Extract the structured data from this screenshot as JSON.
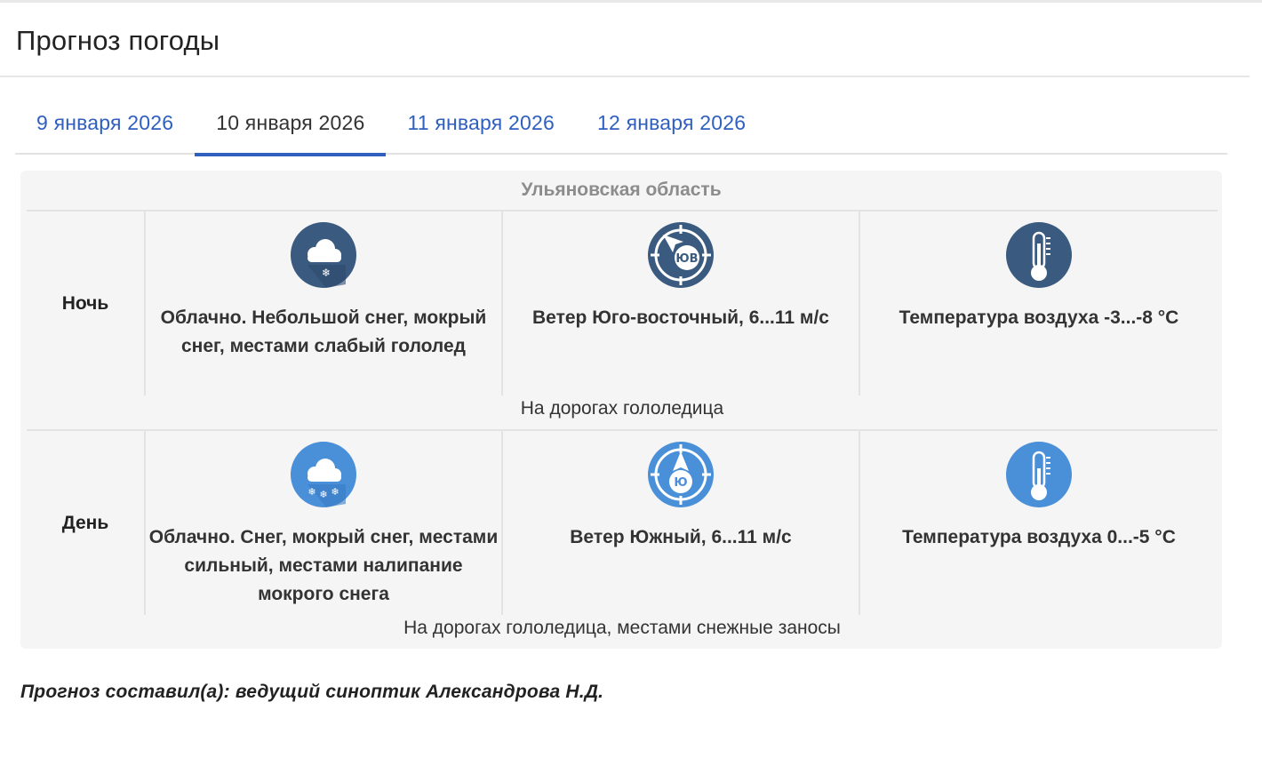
{
  "page": {
    "title": "Прогноз погоды"
  },
  "tabs": [
    {
      "label": "9 января 2026",
      "active": false
    },
    {
      "label": "10 января 2026",
      "active": true
    },
    {
      "label": "11 января 2026",
      "active": false
    },
    {
      "label": "12 января 2026",
      "active": false
    }
  ],
  "forecast": {
    "region": "Ульяновская область",
    "night": {
      "label": "Ночь",
      "weather": "Облачно. Небольшой снег, мокрый снег, местами слабый гололед",
      "wind": "Ветер Юго-восточный, 6...11 м/с",
      "wind_icon_text": "ЮВ",
      "temperature": "Температура воздуха -3...-8 °C",
      "road": "На дорогах гололедица",
      "icon_color": "#3a5a7f"
    },
    "day": {
      "label": "День",
      "weather": "Облачно. Снег, мокрый снег, местами сильный, местами налипание мокрого снега",
      "wind": "Ветер Южный, 6...11 м/с",
      "wind_icon_text": "Ю",
      "temperature": "Температура воздуха 0...-5 °C",
      "road": "На дорогах гололедица, местами снежные заносы",
      "icon_color": "#4a90d9"
    }
  },
  "author": "Прогноз составил(а): ведущий синоптик Александрова Н.Д.",
  "icons": {
    "weather_night": "cloud-light-snow-icon",
    "wind_night": "wind-southeast-icon",
    "temp_night": "thermometer-icon",
    "weather_day": "cloud-snow-icon",
    "wind_day": "wind-south-icon",
    "temp_day": "thermometer-icon"
  }
}
